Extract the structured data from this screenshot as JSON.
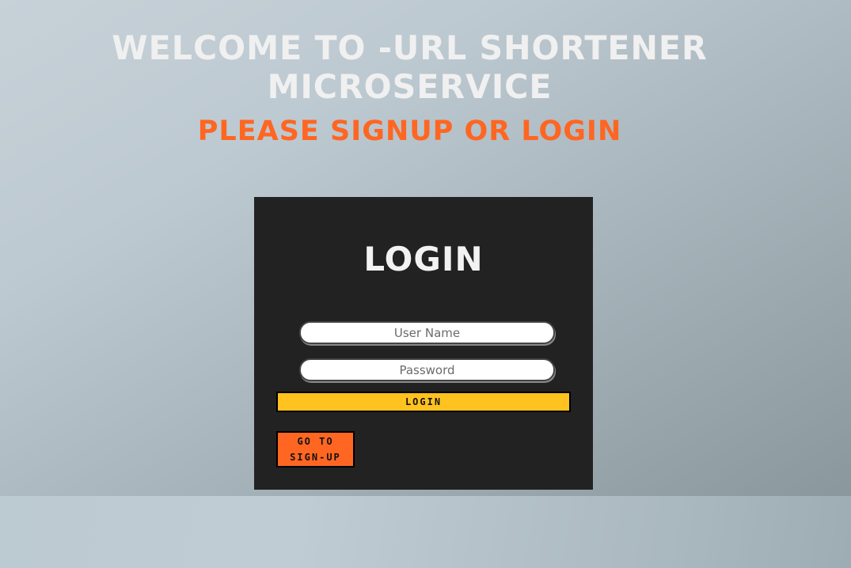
{
  "header": {
    "welcome_text": "WELCOME TO -URL SHORTENER MICROSERVICE",
    "prompt_text": "PLEASE SIGNUP OR LOGIN"
  },
  "login_card": {
    "title": "LOGIN",
    "username": {
      "value": "",
      "placeholder": "User Name"
    },
    "password": {
      "value": "",
      "placeholder": "Password"
    },
    "login_button_label": "LOGIN",
    "signup_button_label": "GO TO SIGN-UP"
  },
  "colors": {
    "accent_orange": "#ff6622",
    "login_button": "#ffc21f",
    "card_background": "#222222",
    "heading_text": "#f0f0f0"
  }
}
